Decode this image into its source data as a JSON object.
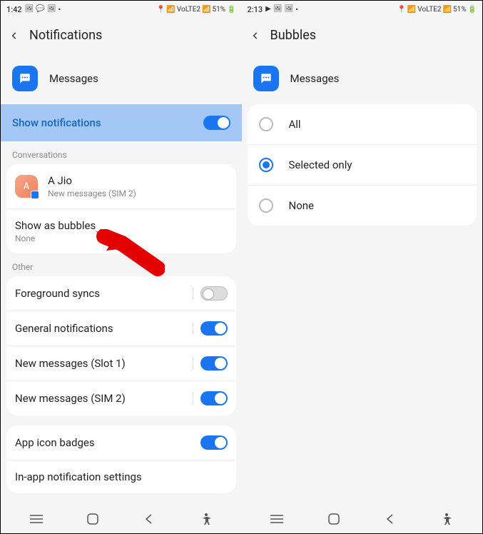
{
  "left": {
    "status": {
      "time": "1:42",
      "battery": "51%",
      "network": "VoLTE2"
    },
    "title": "Notifications",
    "app": "Messages",
    "highlight_label": "Show notifications",
    "conversations_header": "Conversations",
    "convo": {
      "initial": "A",
      "name": "A Jio",
      "sub": "New messages (SIM 2)"
    },
    "show_bubbles": {
      "title": "Show as bubbles",
      "sub": "None"
    },
    "other_header": "Other",
    "other_items": [
      {
        "label": "Foreground syncs",
        "on": false
      },
      {
        "label": "General notifications",
        "on": true
      },
      {
        "label": "New messages (Slot 1)",
        "on": true
      },
      {
        "label": "New messages (SIM 2)",
        "on": true
      }
    ],
    "badges_label": "App icon badges",
    "inapp_label": "In-app notification settings"
  },
  "right": {
    "status": {
      "time": "2:13",
      "battery": "51%",
      "network": "VoLTE2"
    },
    "title": "Bubbles",
    "app": "Messages",
    "options": [
      {
        "label": "All",
        "selected": false
      },
      {
        "label": "Selected only",
        "selected": true
      },
      {
        "label": "None",
        "selected": false
      }
    ]
  }
}
